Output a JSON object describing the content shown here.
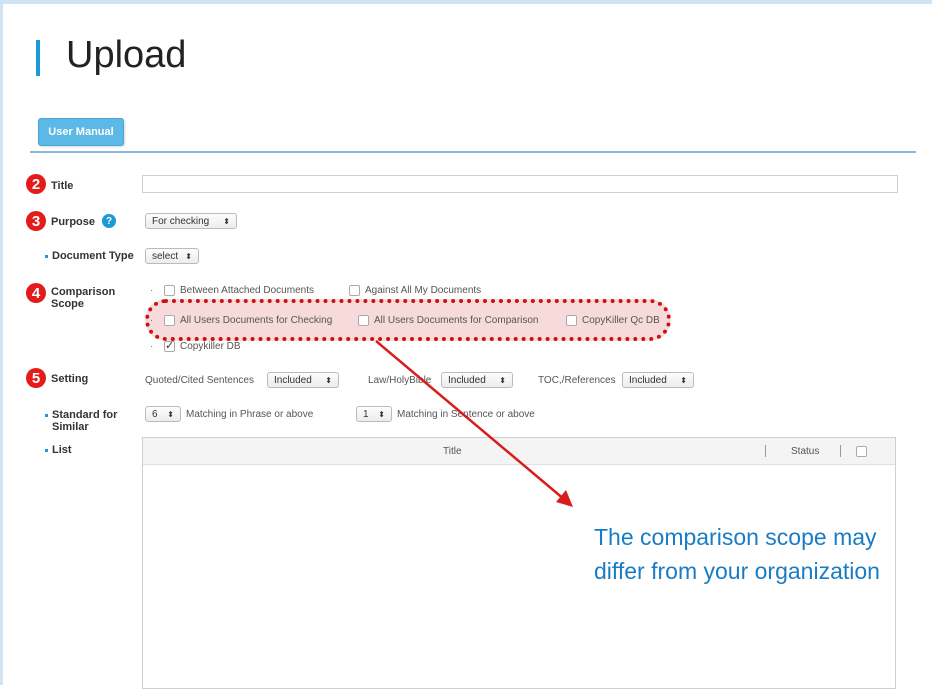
{
  "page": {
    "title": "Upload"
  },
  "user_manual_button": "User Manual",
  "badges": {
    "title": "2",
    "purpose": "3",
    "comparison": "4",
    "setting": "5"
  },
  "help_icon": "?",
  "labels": {
    "title": "Title",
    "purpose": "Purpose",
    "document_type": "Document Type",
    "comparison_scope_line1": "Comparison",
    "comparison_scope_line2": "Scope",
    "setting": "Setting",
    "standard_line1": "Standard for",
    "standard_line2": "Similar",
    "list": "List"
  },
  "title_input": {
    "value": ""
  },
  "purpose_select": {
    "value": "For checking"
  },
  "document_type_select": {
    "value": "select"
  },
  "comparison_scope": {
    "options": [
      {
        "label": "Between Attached Documents",
        "checked": false
      },
      {
        "label": "Against All My Documents",
        "checked": false
      },
      {
        "label": "All Users Documents for Checking",
        "checked": false
      },
      {
        "label": "All Users Documents for Comparison",
        "checked": false
      },
      {
        "label": "CopyKiller Qc DB",
        "checked": false
      },
      {
        "label": "Copykiller DB",
        "checked": true
      }
    ]
  },
  "setting": {
    "quoted_label": "Quoted/Cited Sentences",
    "quoted_value": "Included",
    "law_label": "Law/HolyBible",
    "law_value": "Included",
    "toc_label": "TOC,/References",
    "toc_value": "Included"
  },
  "standard": {
    "phrase_value": "6",
    "phrase_label": "Matching in Phrase or above",
    "sentence_value": "1",
    "sentence_label": "Matching in Sentence or above"
  },
  "list": {
    "col_title": "Title",
    "col_status": "Status"
  },
  "annotation": {
    "line1": "The comparison scope may",
    "line2": "differ from your organization"
  },
  "colors": {
    "accent": "#1a9ad6",
    "highlight": "#cc1111",
    "annotation": "#1a7cc4"
  }
}
